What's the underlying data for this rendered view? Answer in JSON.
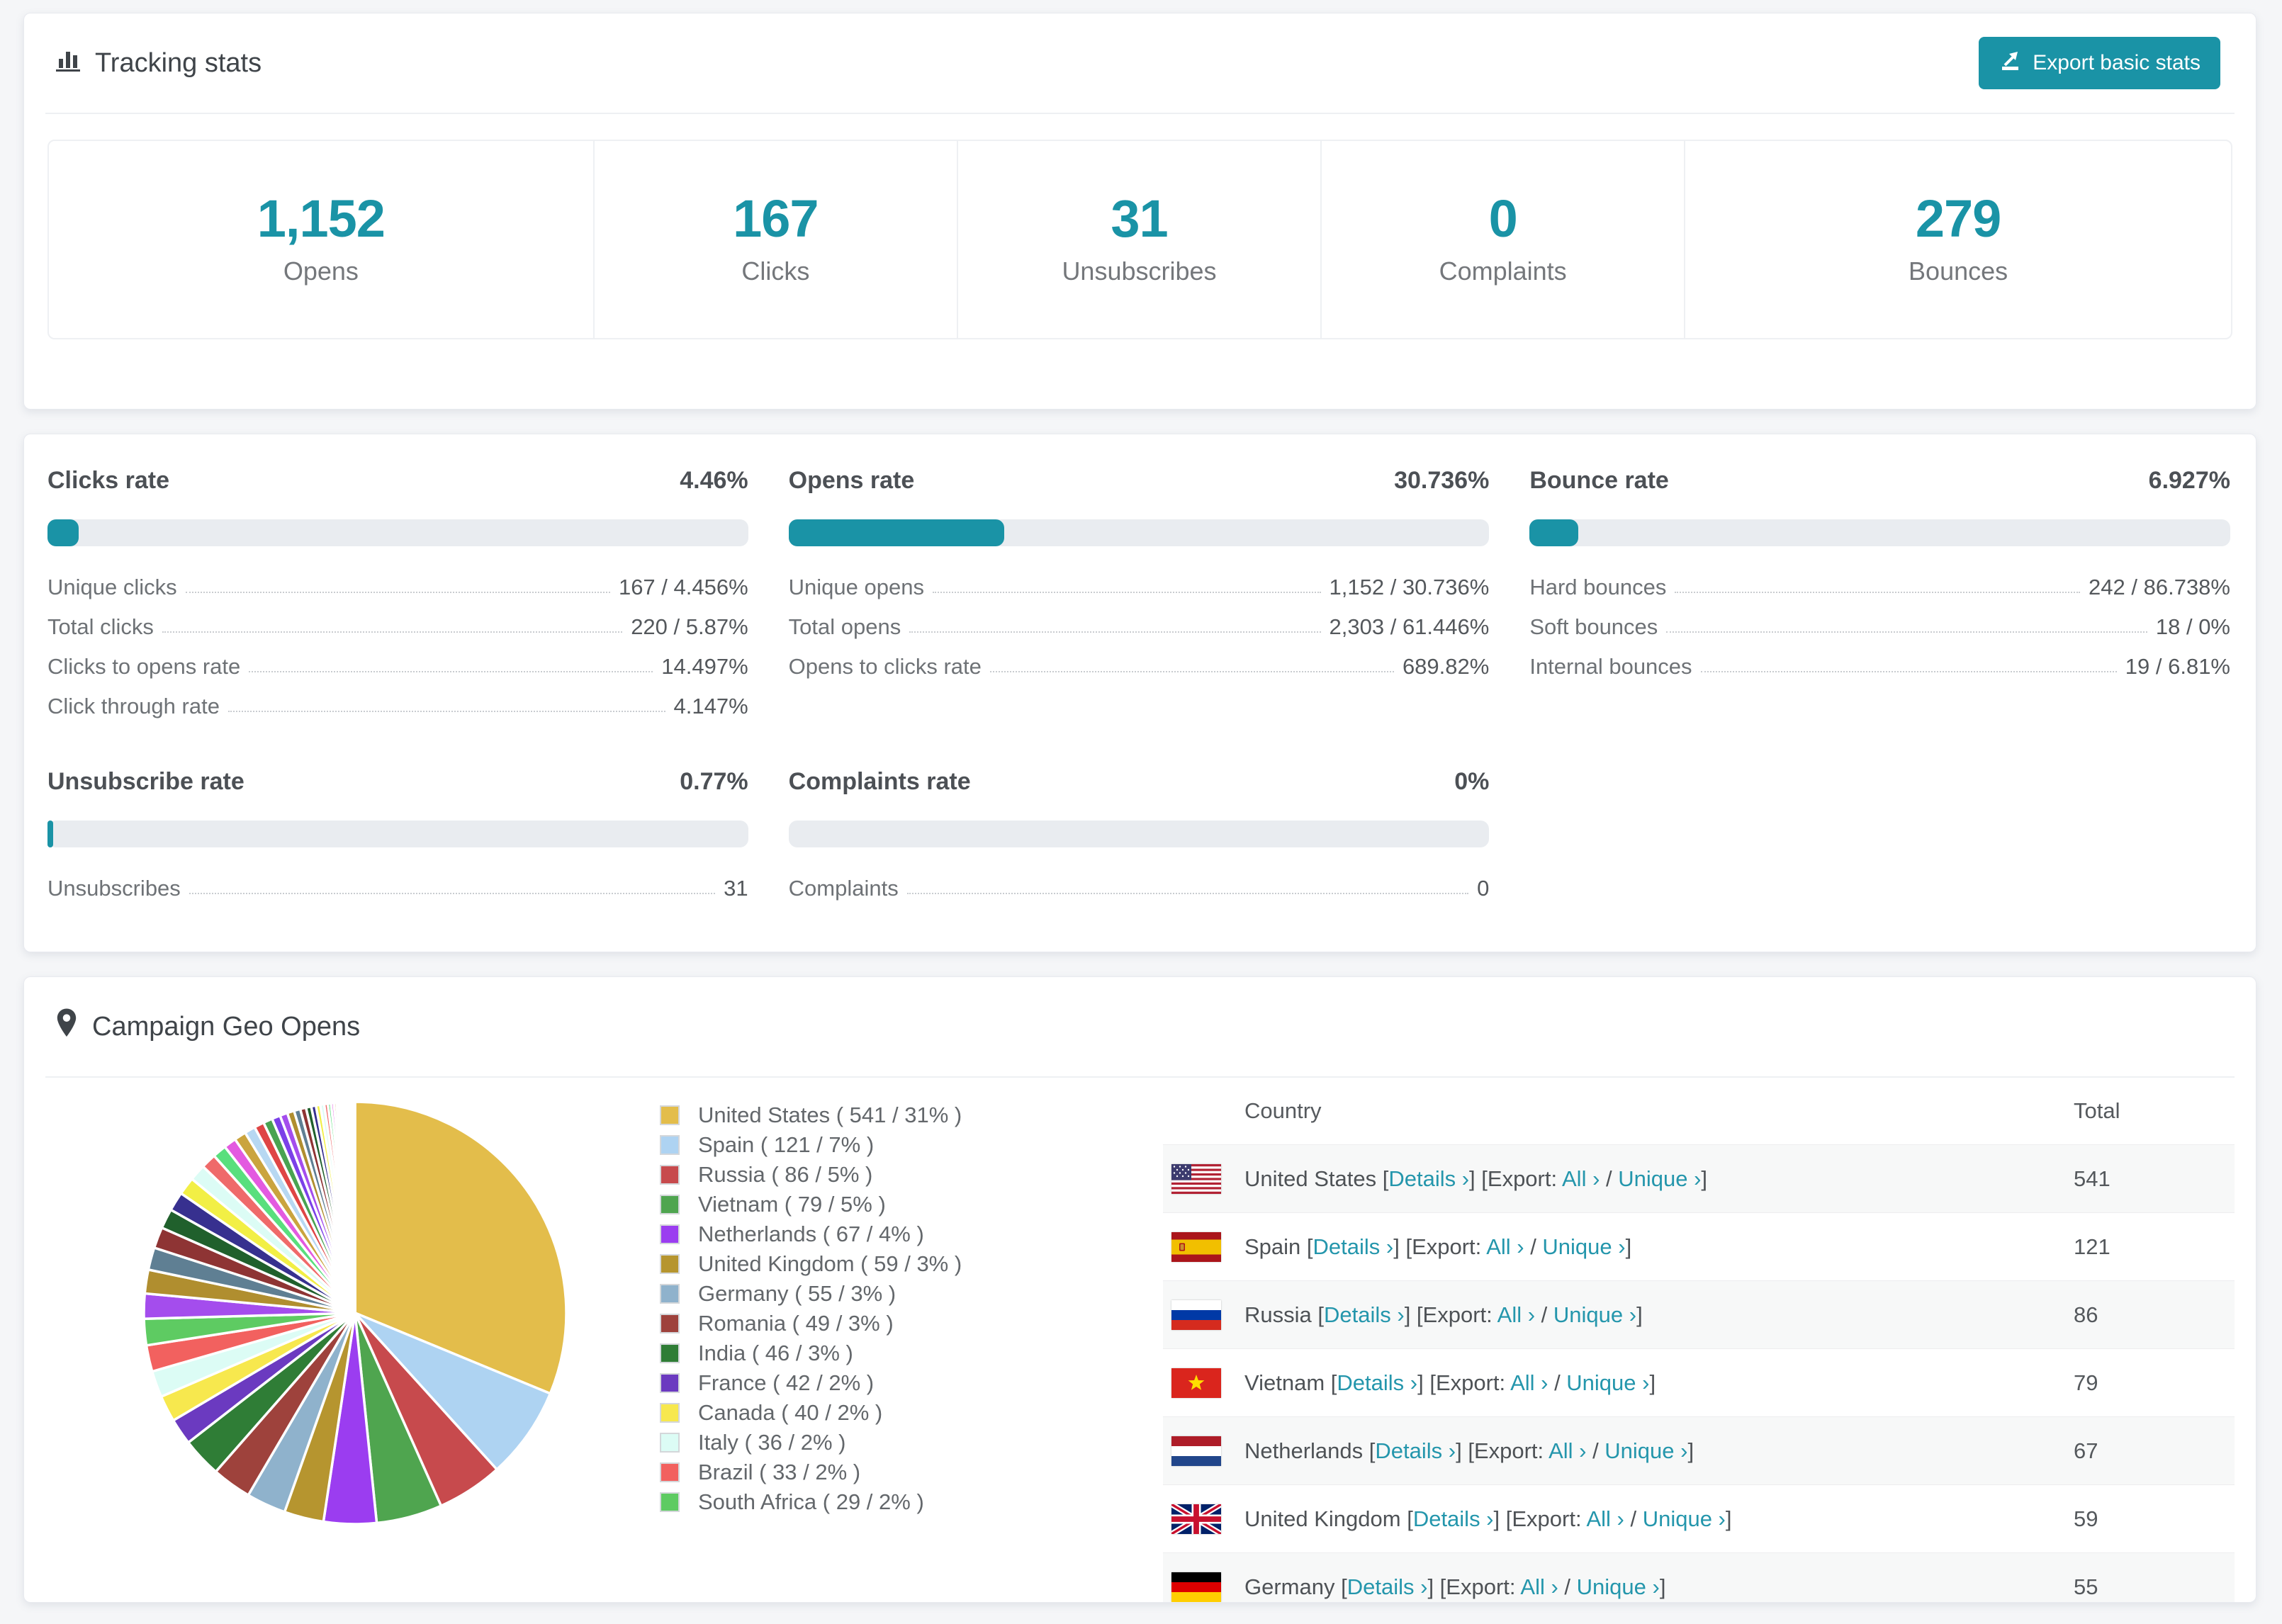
{
  "colors": {
    "accent_teal": "#1a93a6",
    "link_teal": "#2496ac",
    "page_background": "#f5f6f8"
  },
  "tracking": {
    "title": "Tracking stats",
    "title_icon": "bar-chart-icon",
    "export_label": "Export basic stats",
    "stats": [
      {
        "value": "1,152",
        "label": "Opens"
      },
      {
        "value": "167",
        "label": "Clicks"
      },
      {
        "value": "31",
        "label": "Unsubscribes"
      },
      {
        "value": "0",
        "label": "Complaints"
      },
      {
        "value": "279",
        "label": "Bounces"
      }
    ]
  },
  "rates": {
    "blocks": [
      {
        "title": "Clicks rate",
        "value": "4.46%",
        "percent": 4.46,
        "rows": [
          {
            "label": "Unique clicks",
            "value": "167 / 4.456%"
          },
          {
            "label": "Total clicks",
            "value": "220 / 5.87%"
          },
          {
            "label": "Clicks to opens rate",
            "value": "14.497%"
          },
          {
            "label": "Click through rate",
            "value": "4.147%"
          }
        ]
      },
      {
        "title": "Opens rate",
        "value": "30.736%",
        "percent": 30.736,
        "rows": [
          {
            "label": "Unique opens",
            "value": "1,152 / 30.736%"
          },
          {
            "label": "Total opens",
            "value": "2,303 / 61.446%"
          },
          {
            "label": "Opens to clicks rate",
            "value": "689.82%"
          }
        ]
      },
      {
        "title": "Bounce rate",
        "value": "6.927%",
        "percent": 6.927,
        "rows": [
          {
            "label": "Hard bounces",
            "value": "242 / 86.738%"
          },
          {
            "label": "Soft bounces",
            "value": "18 / 0%"
          },
          {
            "label": "Internal bounces",
            "value": "19 / 6.81%"
          }
        ]
      },
      {
        "title": "Unsubscribe rate",
        "value": "0.77%",
        "percent": 0.77,
        "rows": [
          {
            "label": "Unsubscribes",
            "value": "31"
          }
        ]
      },
      {
        "title": "Complaints rate",
        "value": "0%",
        "percent": 0,
        "rows": [
          {
            "label": "Complaints",
            "value": "0"
          }
        ]
      }
    ]
  },
  "geo": {
    "title": "Campaign Geo Opens",
    "title_icon": "map-pin-icon",
    "chart_data": {
      "type": "pie",
      "title": "Campaign Geo Opens",
      "legend_position": "right",
      "start_angle_deg": 0,
      "direction": "clockwise",
      "categories": [
        "United States",
        "Spain",
        "Russia",
        "Vietnam",
        "Netherlands",
        "United Kingdom",
        "Germany",
        "Romania",
        "India",
        "France",
        "Canada",
        "Italy",
        "Brazil",
        "South Africa"
      ],
      "values": [
        541,
        121,
        86,
        79,
        67,
        59,
        55,
        49,
        46,
        42,
        40,
        36,
        33,
        29
      ],
      "percents": [
        31,
        7,
        5,
        5,
        4,
        3,
        3,
        3,
        3,
        2,
        2,
        2,
        2,
        2
      ],
      "colors": [
        "#e3bd4b",
        "#aed3f2",
        "#c74a4d",
        "#4fa54f",
        "#9b3df0",
        "#b6952f",
        "#8fb2cc",
        "#9e423c",
        "#2f7d36",
        "#6b3ac0",
        "#f7e84e",
        "#dcfcf5",
        "#f2615f",
        "#5ecb62"
      ],
      "others": {
        "note": "many small unlabeled country slices",
        "percent_total": 25.25,
        "slices": [
          1.9,
          1.8,
          1.7,
          1.6,
          1.5,
          1.45,
          1.35,
          1.25,
          1.15,
          1.05,
          0.95,
          0.9,
          0.82,
          0.75,
          0.7,
          0.64,
          0.58,
          0.53,
          0.48,
          0.44,
          0.4,
          0.36,
          0.33,
          0.3,
          0.27,
          0.24,
          0.22,
          0.2,
          0.18,
          0.16,
          0.14,
          0.12,
          0.11,
          0.1,
          0.09,
          0.08,
          0.07,
          0.06,
          0.05,
          0.05,
          0.04,
          0.04,
          0.03,
          0.03,
          0.02,
          0.02
        ],
        "palette": [
          "#a44ded",
          "#b08e2f",
          "#5f7f93",
          "#8e3434",
          "#20602c",
          "#37308f",
          "#f2ef45",
          "#dcfcf5",
          "#ef6a6a",
          "#59df7d",
          "#e35ae0",
          "#caa43e",
          "#b7d8f2",
          "#df4545",
          "#49a351",
          "#7b40e8"
        ]
      }
    },
    "legend_format": "name ( value / percent% )",
    "table": {
      "headers": [
        "Country",
        "Total"
      ],
      "link_labels": {
        "details": "Details",
        "export": "Export:",
        "all": "All",
        "unique": "Unique",
        "chevron": "›"
      },
      "rows": [
        {
          "country": "United States",
          "flag": "us",
          "total": "541"
        },
        {
          "country": "Spain",
          "flag": "es",
          "total": "121"
        },
        {
          "country": "Russia",
          "flag": "ru",
          "total": "86"
        },
        {
          "country": "Vietnam",
          "flag": "vn",
          "total": "79"
        },
        {
          "country": "Netherlands",
          "flag": "nl",
          "total": "67"
        },
        {
          "country": "United Kingdom",
          "flag": "gb",
          "total": "59"
        },
        {
          "country": "Germany",
          "flag": "de",
          "total": "55",
          "partial": true
        }
      ]
    }
  }
}
